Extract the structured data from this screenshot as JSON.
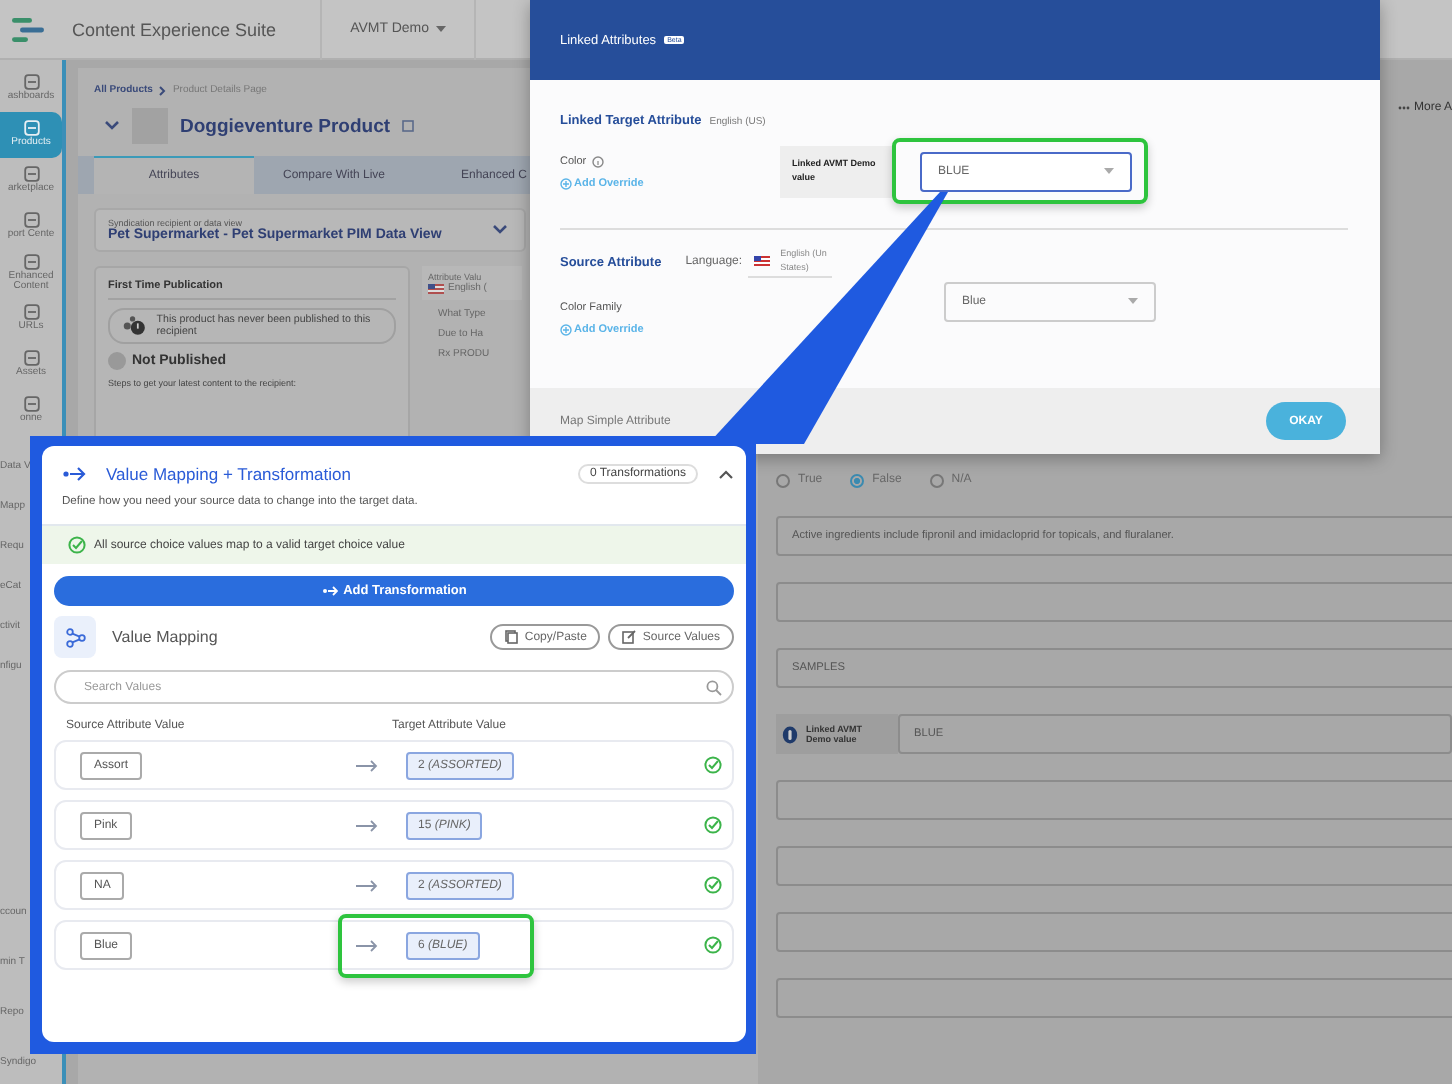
{
  "top_bar": {
    "app_name": "Content Experience Suite",
    "account": "AVMT Demo"
  },
  "sidebar": {
    "items": [
      {
        "label": "ashboards",
        "selected": false
      },
      {
        "label": "Products",
        "selected": true
      },
      {
        "label": "arketplace",
        "selected": false
      },
      {
        "label": "port Cente",
        "selected": false
      },
      {
        "label": "Enhanced Content",
        "selected": false
      },
      {
        "label": "URLs",
        "selected": false
      },
      {
        "label": "Assets",
        "selected": false
      },
      {
        "label": "onne",
        "selected": false
      }
    ],
    "lower_items": [
      "Data V",
      "Mapp",
      "Requ",
      "eCat",
      "ctivit",
      "nfigu"
    ],
    "bottom_items": [
      "ccoun",
      "min T",
      "Repo",
      "Syndigo"
    ]
  },
  "page": {
    "breadcrumb": [
      "All Products",
      "Product Details Page"
    ],
    "product_title": "Doggieventure Product",
    "tabs": [
      {
        "label": "Attributes",
        "selected": true
      },
      {
        "label": "Compare With Live",
        "selected": false
      },
      {
        "label": "Enhanced C",
        "selected": false
      }
    ],
    "data_view": {
      "label": "Syndication recipient or data view",
      "value": "Pet Supermarket - Pet Supermarket PIM Data View"
    },
    "publication": {
      "title": "First Time Publication",
      "message": "This product has never been published to this recipient",
      "status": "Not Published",
      "steps": "Steps to get your latest content to the recipient:"
    },
    "attribute_column": {
      "header": "Attribute Valu",
      "language": "English (",
      "items": [
        "What Type",
        "Due to Ha",
        "Rx PRODU"
      ]
    },
    "more_actions": "More A",
    "form_rows": [
      {
        "kind": "radio",
        "options": [
          {
            "label": "True",
            "selected": false
          },
          {
            "label": "False",
            "selected": true
          },
          {
            "label": "N/A",
            "selected": false
          }
        ]
      },
      {
        "kind": "text",
        "value": "Active ingredients include fipronil and imidacloprid for topicals, and fluralaner."
      },
      {
        "kind": "text"
      },
      {
        "kind": "text",
        "value": "SAMPLES"
      },
      {
        "kind": "linked",
        "label": "Linked AVMT Demo value",
        "value": "BLUE"
      },
      {
        "kind": "text"
      },
      {
        "kind": "text"
      },
      {
        "kind": "text"
      },
      {
        "kind": "text"
      }
    ]
  },
  "modal": {
    "title": "Linked Attributes",
    "badge": "Beta",
    "target": {
      "heading": "Linked Target Attribute",
      "language": "English (US)",
      "attribute": "Color",
      "override": "Add Override",
      "linked_label": "Linked AVMT Demo value",
      "value": "BLUE",
      "highlighted": true
    },
    "source": {
      "heading": "Source Attribute",
      "language_label": "Language:",
      "language_lines": [
        "English (Un",
        "States)"
      ],
      "attribute": "Color Family",
      "override": "Add Override",
      "value": "Blue"
    },
    "footer_text": "Map Simple Attribute",
    "ok": "OKAY"
  },
  "callout": {
    "title": "Value Mapping + Transformation",
    "count": "0 Transformations",
    "expanded": true,
    "description": "Define how you need your source data to change into the target data.",
    "status": "All source choice values map to a valid target choice value",
    "add_button": "Add Transformation",
    "section_title": "Value Mapping",
    "actions": [
      "Copy/Paste",
      "Source Values"
    ],
    "search_placeholder": "Search Values",
    "columns": [
      "Source Attribute Value",
      "Target Attribute Value"
    ],
    "rows": [
      {
        "source": "Assort",
        "target": "2 *(ASSORTED)*",
        "highlighted": false
      },
      {
        "source": "Pink",
        "target": "15 *(PINK)*",
        "highlighted": false
      },
      {
        "source": "NA",
        "target": "2 *(ASSORTED)*",
        "highlighted": false
      },
      {
        "source": "Blue",
        "target": "6 *(BLUE)*",
        "highlighted": true
      }
    ]
  }
}
